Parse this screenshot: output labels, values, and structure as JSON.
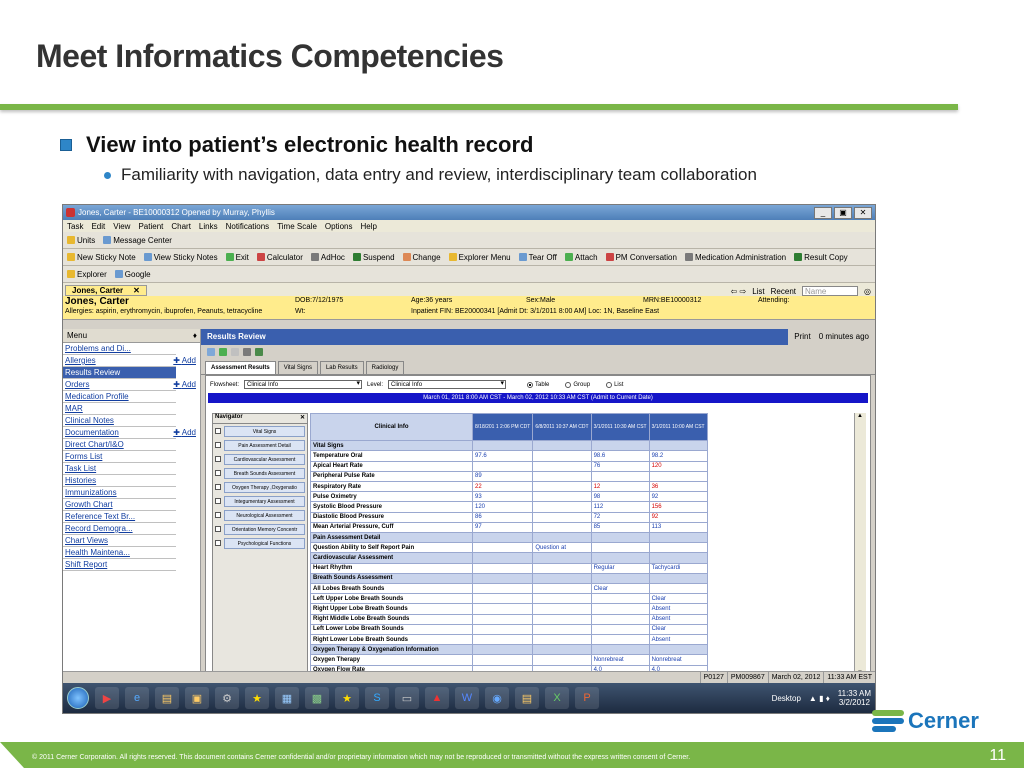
{
  "slide": {
    "title": "Meet Informatics Competencies",
    "bullet1": "View into patient’s electronic health record",
    "bullet2": "Familiarity with navigation, data entry and review, interdisciplinary team collaboration",
    "footer": "© 2011 Cerner Corporation. All rights reserved. This document contains Cerner confidential and/or proprietary information which may not be reproduced or transmitted without the express written consent of Cerner.",
    "page_number": "11",
    "logo_text": "Cerner",
    "colors": {
      "accent_green": "#7ab648",
      "bullet_blue": "#2e86c8",
      "logo_blue": "#1b75bb"
    }
  },
  "app": {
    "window_title": "Jones, Carter - BE10000312 Opened by Murray, Phyllis",
    "menu": [
      "Task",
      "Edit",
      "View",
      "Patient",
      "Chart",
      "Links",
      "Notifications",
      "Time Scale",
      "Options",
      "Help"
    ],
    "toolbar1": [
      "Units",
      "Message Center"
    ],
    "toolbar2": [
      "New Sticky Note",
      "View Sticky Notes",
      "Exit",
      "Calculator",
      "AdHoc",
      "Suspend",
      "Change",
      "Explorer Menu",
      "Tear Off",
      "Attach",
      "PM Conversation",
      "Medication Administration",
      "Result Copy"
    ],
    "toolbar3": [
      "Explorer",
      "Google"
    ],
    "patient_tab": "Jones, Carter",
    "nav_list": "List",
    "nav_recent": "Recent",
    "name_placeholder": "Name",
    "banner": {
      "name": "Jones, Carter",
      "allergies": "Allergies: aspirin, erythromycin, ibuprofen, Peanuts, tetracycline",
      "dob": "DOB:7/12/1975",
      "wt": "Wt:",
      "age": "Age:36 years",
      "sex": "Sex:Male",
      "mrn": "MRN:BE10000312",
      "attending": "Attending:",
      "encounter": "Inpatient FIN: BE20000341 [Admit Dt: 3/1/2011 8:00 AM] Loc: 1N, Baseline East"
    },
    "left_menu": {
      "header": "Menu",
      "add_label": "Add",
      "items": [
        {
          "label": "Problems and Di...",
          "add": false
        },
        {
          "label": "Allergies",
          "add": true
        },
        {
          "label": "Results Review",
          "add": false
        },
        {
          "label": "Orders",
          "add": true
        },
        {
          "label": "Medication Profile",
          "add": false
        },
        {
          "label": "MAR",
          "add": false
        },
        {
          "label": "Clinical Notes",
          "add": false
        },
        {
          "label": "Documentation",
          "add": true
        },
        {
          "label": "Direct Chart/I&O",
          "add": false
        },
        {
          "label": "Forms List",
          "add": false
        },
        {
          "label": "Task List",
          "add": false
        },
        {
          "label": "Histories",
          "add": false
        },
        {
          "label": "Immunizations",
          "add": false
        },
        {
          "label": "Growth Chart",
          "add": false
        },
        {
          "label": "Reference Text Br...",
          "add": false
        },
        {
          "label": "Record Demogra...",
          "add": false
        },
        {
          "label": "Chart Views",
          "add": false
        },
        {
          "label": "Health Maintena...",
          "add": false
        },
        {
          "label": "Shift Report",
          "add": false
        }
      ]
    },
    "results": {
      "header": "Results Review",
      "print": "Print",
      "refresh": "0 minutes ago",
      "tabs": [
        "Assessment Results",
        "Vital Signs",
        "Lab Results",
        "Radiology"
      ],
      "flowsheet_label": "Flowsheet:",
      "flowsheet_value": "Clinical Info",
      "level_label": "Level:",
      "level_value": "Clinical Info",
      "view_options": [
        "Table",
        "Group",
        "List"
      ],
      "date_range": "March 01, 2011 8:00 AM CST - March 02, 2012 10:33 AM CST (Admit to Current Date)",
      "navigator": {
        "title": "Navigator",
        "items": [
          "Vital Signs",
          "Pain Assessment Detail",
          "Cardiovascular Assessment",
          "Breath Sounds Assessment",
          "Oxygen Therapy ,Oxygenatio",
          "Integumentary Assessment",
          "Neurological Assessment",
          "Orientation Memory Concentr",
          "Psychological Functions"
        ]
      },
      "grid": {
        "corner": "Clinical Info",
        "columns": [
          "8/18/201 1 2:06 PM CDT",
          "6/8/2011 10:37 AM CDT",
          "3/1/2011 10:30 AM CST",
          "3/1/2011 10:00 AM CST"
        ],
        "rows": [
          {
            "label": "Vital Signs",
            "section": true,
            "cells": [
              "",
              "",
              "",
              ""
            ]
          },
          {
            "label": "Temperature Oral",
            "cells": [
              "97.6",
              "",
              "98.6",
              "98.2"
            ],
            "red": []
          },
          {
            "label": "Apical Heart Rate",
            "cells": [
              "",
              "",
              "76",
              "120"
            ],
            "red": [
              3
            ]
          },
          {
            "label": "Peripheral Pulse Rate",
            "cells": [
              "89",
              "",
              "",
              ""
            ],
            "red": []
          },
          {
            "label": "Respiratory Rate",
            "cells": [
              "22",
              "",
              "12",
              "36"
            ],
            "red": [
              0,
              2,
              3
            ]
          },
          {
            "label": "Pulse Oximetry",
            "cells": [
              "93",
              "",
              "98",
              "92"
            ],
            "red": []
          },
          {
            "label": "Systolic Blood Pressure",
            "cells": [
              "120",
              "",
              "112",
              "156"
            ],
            "red": [
              3
            ]
          },
          {
            "label": "Diastolic Blood Pressure",
            "cells": [
              "86",
              "",
              "72",
              "92"
            ],
            "red": [
              3
            ]
          },
          {
            "label": "Mean Arterial Pressure, Cuff",
            "cells": [
              "97",
              "",
              "85",
              "113"
            ],
            "red": []
          },
          {
            "label": "Pain Assessment Detail",
            "section": true,
            "cells": [
              "",
              "",
              "",
              ""
            ]
          },
          {
            "label": "Question Ability to Self Report Pain",
            "cells": [
              "",
              "Question at",
              "",
              ""
            ],
            "red": []
          },
          {
            "label": "Cardiovascular Assessment",
            "section": true,
            "cells": [
              "",
              "",
              "",
              ""
            ]
          },
          {
            "label": "Heart Rhythm",
            "cells": [
              "",
              "",
              "Regular",
              "Tachycardi"
            ],
            "red": []
          },
          {
            "label": "Breath Sounds Assessment",
            "section": true,
            "cells": [
              "",
              "",
              "",
              ""
            ]
          },
          {
            "label": "All Lobes Breath Sounds",
            "cells": [
              "",
              "",
              "Clear",
              ""
            ],
            "red": []
          },
          {
            "label": "Left Upper Lobe Breath Sounds",
            "cells": [
              "",
              "",
              "",
              "Clear"
            ],
            "red": []
          },
          {
            "label": "Right Upper Lobe Breath Sounds",
            "cells": [
              "",
              "",
              "",
              "Absent"
            ],
            "red": []
          },
          {
            "label": "Right Middle Lobe Breath Sounds",
            "cells": [
              "",
              "",
              "",
              "Absent"
            ],
            "red": []
          },
          {
            "label": "Left Lower Lobe Breath Sounds",
            "cells": [
              "",
              "",
              "",
              "Clear"
            ],
            "red": []
          },
          {
            "label": "Right Lower Lobe Breath Sounds",
            "cells": [
              "",
              "",
              "",
              "Absent"
            ],
            "red": []
          },
          {
            "label": "Oxygen Therapy & Oxygenation Information",
            "section": true,
            "cells": [
              "",
              "",
              "",
              ""
            ]
          },
          {
            "label": "Oxygen Therapy",
            "cells": [
              "",
              "",
              "Nonrebreat",
              "Nonrebreat"
            ],
            "red": []
          },
          {
            "label": "Oxygen Flow Rate",
            "cells": [
              "",
              "",
              "4.0",
              "4.0"
            ],
            "red": []
          }
        ]
      }
    },
    "status": {
      "user": "P0127",
      "id": "PM009867",
      "date": "March 02, 2012",
      "time": "11:33 AM EST"
    },
    "taskbar": {
      "desktop": "Desktop",
      "time": "11:33 AM",
      "date": "3/2/2012"
    }
  }
}
